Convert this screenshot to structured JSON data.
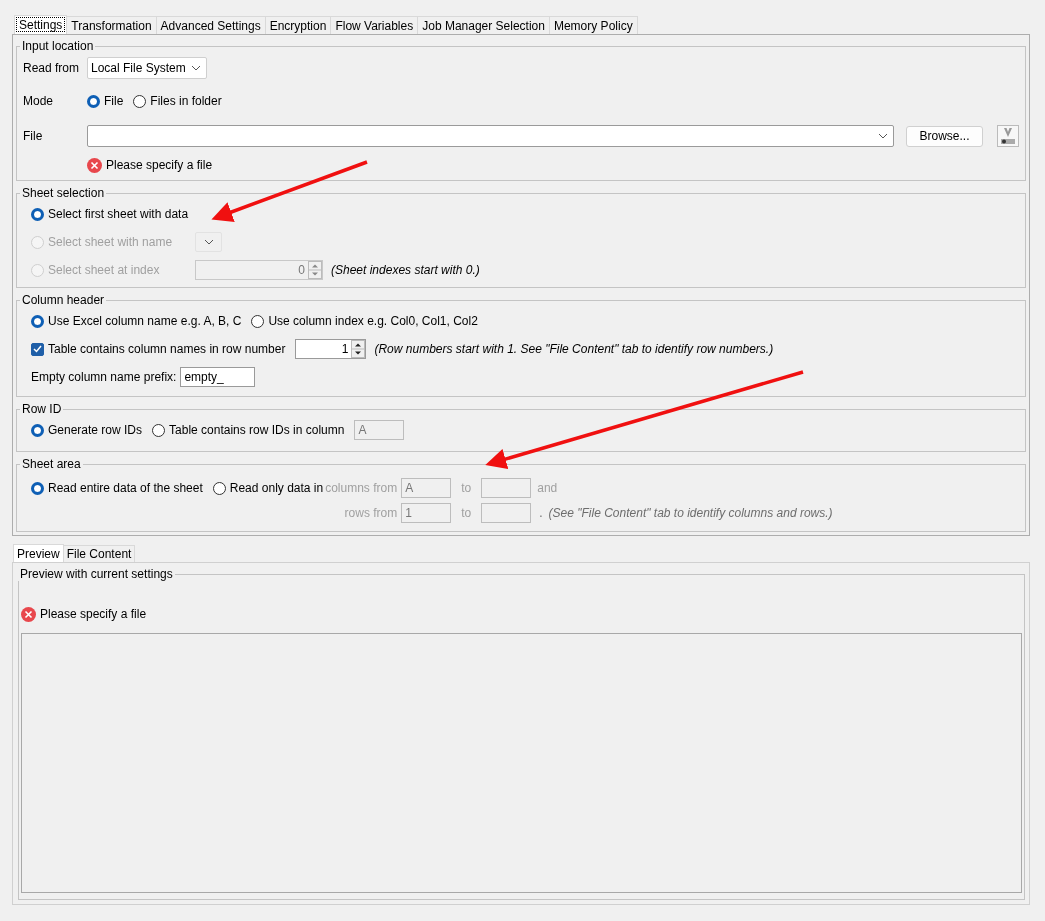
{
  "tabs": [
    {
      "label": "Settings",
      "selected": true
    },
    {
      "label": "Transformation",
      "selected": false
    },
    {
      "label": "Advanced Settings",
      "selected": false
    },
    {
      "label": "Encryption",
      "selected": false
    },
    {
      "label": "Flow Variables",
      "selected": false
    },
    {
      "label": "Job Manager Selection",
      "selected": false
    },
    {
      "label": "Memory Policy",
      "selected": false
    }
  ],
  "input_location": {
    "title": "Input location",
    "read_from": {
      "label": "Read from",
      "value": "Local File System"
    },
    "mode": {
      "label": "Mode",
      "options": [
        {
          "label": "File",
          "selected": true
        },
        {
          "label": "Files in folder",
          "selected": false
        }
      ]
    },
    "file": {
      "label": "File",
      "button": "Browse..."
    },
    "error": "Please specify a file"
  },
  "sheet_selection": {
    "title": "Sheet selection",
    "options": [
      {
        "kind": "plain",
        "label": "Select first sheet with data",
        "selected": true,
        "disabled": false
      },
      {
        "kind": "dropdown",
        "label": "Select sheet with name",
        "selected": false,
        "disabled": true
      },
      {
        "kind": "index",
        "label": "Select sheet at index",
        "selected": false,
        "disabled": true,
        "value": "0",
        "note": "(Sheet indexes start with 0.)"
      }
    ]
  },
  "column_header": {
    "title": "Column header",
    "options": [
      {
        "label": "Use Excel column name e.g. A, B, C",
        "selected": true
      },
      {
        "label": "Use column index e.g. Col0, Col1, Col2",
        "selected": false
      }
    ],
    "row_names": {
      "label": "Table contains column names in row number",
      "checked": true,
      "value": "1",
      "note": "(Row numbers start with 1. See \"File Content\" tab to identify row numbers.)"
    },
    "prefix": {
      "label": "Empty column name prefix:",
      "value": "empty_"
    }
  },
  "row_id": {
    "title": "Row ID",
    "options": [
      {
        "label": "Generate row IDs",
        "selected": true
      },
      {
        "label": "Table contains row IDs in column",
        "selected": false
      }
    ],
    "column_value": "A",
    "column_disabled": true
  },
  "sheet_area": {
    "title": "Sheet area",
    "options": [
      {
        "label": "Read entire data of the sheet",
        "selected": true
      },
      {
        "label": "Read only data in",
        "selected": false
      }
    ],
    "range_disabled": true,
    "columns_label": "columns from",
    "columns_from": "A",
    "columns_to_label": "to",
    "and_label": "and",
    "rows_label": "rows from",
    "rows_from": "1",
    "rows_to_label": "to",
    "period": ".",
    "note": "(See \"File Content\" tab to identify columns and rows.)"
  },
  "preview_tabs": [
    {
      "label": "Preview",
      "selected": true
    },
    {
      "label": "File Content",
      "selected": false
    }
  ],
  "preview": {
    "title": "Preview with current settings",
    "error": "Please specify a file"
  }
}
